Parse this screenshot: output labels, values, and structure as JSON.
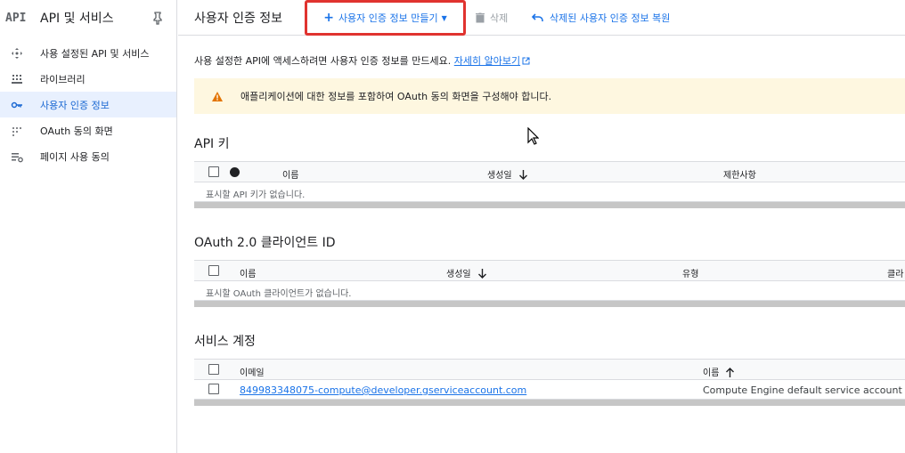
{
  "sidebar": {
    "logo": "API",
    "title": "API 및 서비스",
    "items": [
      {
        "label": "사용 설정된 API 및 서비스",
        "icon": "diamond-arrows-icon"
      },
      {
        "label": "라이브러리",
        "icon": "library-grid-icon"
      },
      {
        "label": "사용자 인증 정보",
        "icon": "key-icon"
      },
      {
        "label": "OAuth 동의 화면",
        "icon": "oauth-dots-icon"
      },
      {
        "label": "페이지 사용 동의",
        "icon": "settings-list-icon"
      }
    ]
  },
  "toolbar": {
    "page_title": "사용자 인증 정보",
    "create_label": "사용자 인증 정보 만들기",
    "delete_label": "삭제",
    "restore_label": "삭제된 사용자 인증 정보 복원"
  },
  "main": {
    "description": "사용 설정한 API에 액세스하려면 사용자 인증 정보를 만드세요.",
    "learn_more": "자세히 알아보기",
    "warning": "애플리케이션에 대한 정보를 포함하여 OAuth 동의 화면을 구성해야 합니다."
  },
  "api_keys": {
    "title": "API 키",
    "columns": [
      "이름",
      "생성일",
      "제한사항"
    ],
    "empty": "표시할 API 키가 없습니다."
  },
  "oauth": {
    "title": "OAuth 2.0 클라이언트 ID",
    "columns": [
      "이름",
      "생성일",
      "유형",
      "클라"
    ],
    "empty": "표시할 OAuth 클라이언트가 없습니다."
  },
  "service_accounts": {
    "title": "서비스 계정",
    "columns": [
      "이메일",
      "이름"
    ],
    "rows": [
      {
        "email": "849983348075-compute@developer.gserviceaccount.com",
        "name": "Compute Engine default service account"
      }
    ]
  },
  "colors": {
    "accent": "#1a73e8",
    "highlight_border": "#e0332f",
    "warning_bg": "#fef7e0",
    "warning_icon": "#e37400",
    "active_bg": "#e8f0fe"
  }
}
